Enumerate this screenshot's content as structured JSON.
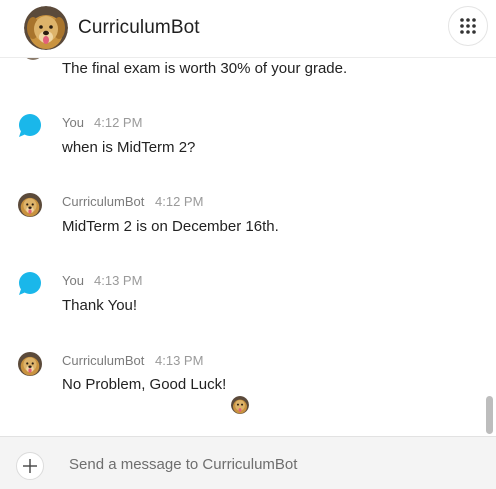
{
  "header": {
    "title": "CurriculumBot",
    "avatar_icon": "dog-avatar-icon",
    "menu_icon": "grid-menu-icon"
  },
  "conversation": {
    "partial_message": "The final exam is worth 30% of your grade.",
    "messages": [
      {
        "sender": "You",
        "time": "4:12 PM",
        "text": "when is MidTerm 2?",
        "avatar_icon": "user-bubble-icon"
      },
      {
        "sender": "CurriculumBot",
        "time": "4:12 PM",
        "text": "MidTerm 2 is on December 16th.",
        "avatar_icon": "dog-avatar-icon"
      },
      {
        "sender": "You",
        "time": "4:13 PM",
        "text": "Thank You!",
        "avatar_icon": "user-bubble-icon"
      },
      {
        "sender": "CurriculumBot",
        "time": "4:13 PM",
        "text": "No Problem, Good Luck!",
        "avatar_icon": "dog-avatar-icon"
      }
    ]
  },
  "composer": {
    "placeholder": "Send a message to CurriculumBot",
    "add_icon": "plus-icon"
  },
  "colors": {
    "user_bubble": "#1ab7ea",
    "composer_bg": "#f4f4f4",
    "text": "#222222",
    "meta": "#7b7b7b"
  }
}
